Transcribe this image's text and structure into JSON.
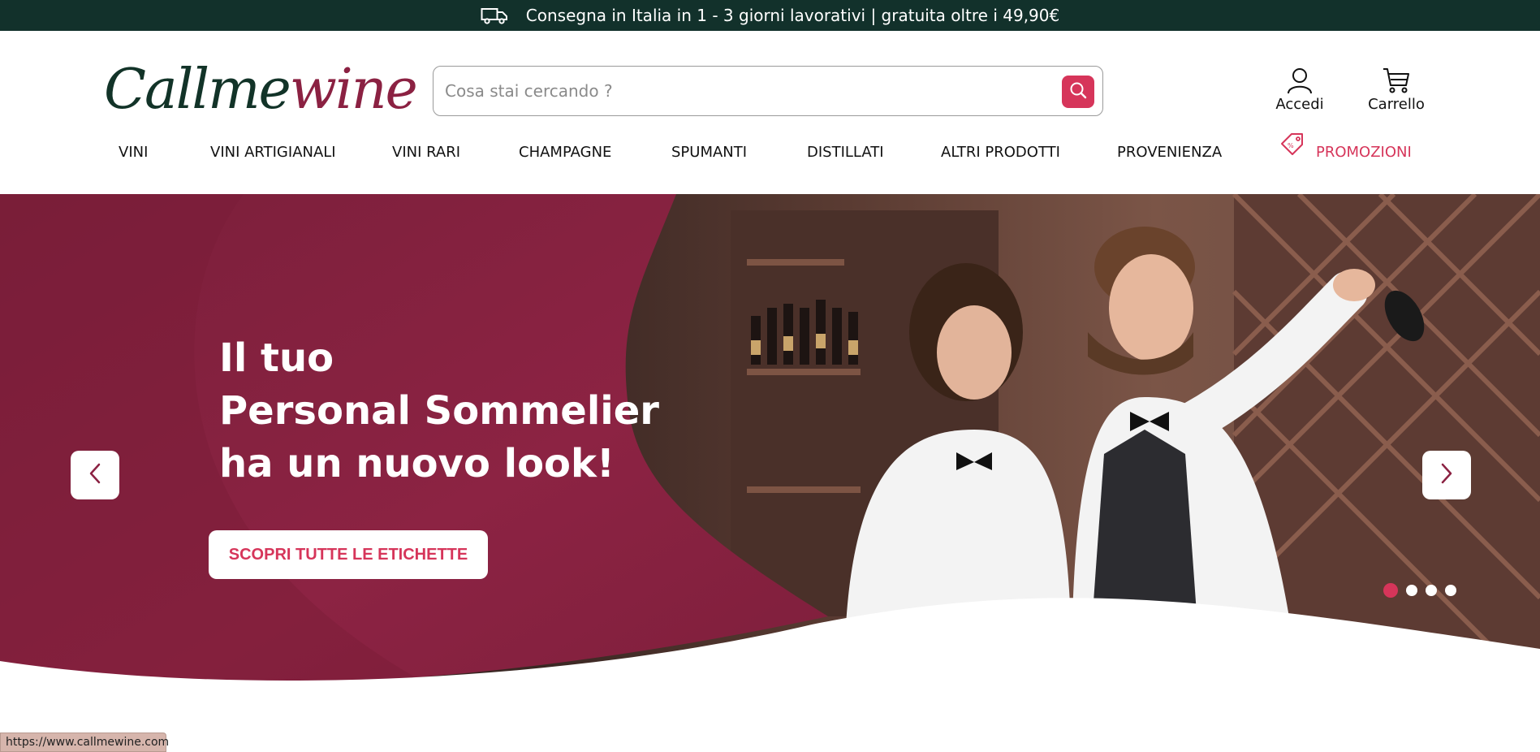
{
  "top_banner": {
    "icon": "truck-icon",
    "text": "Consegna in Italia in 1 - 3 giorni lavorativi | gratuita oltre i 49,90€"
  },
  "header": {
    "logo": {
      "part1": "Callme",
      "part2": "wine"
    },
    "search": {
      "placeholder": "Cosa stai cercando ?",
      "value": "",
      "icon": "search-icon"
    },
    "account": {
      "label": "Accedi",
      "icon": "user-icon"
    },
    "cart": {
      "label": "Carrello",
      "icon": "cart-icon"
    }
  },
  "nav": {
    "items": [
      {
        "label": "VINI"
      },
      {
        "label": "VINI ARTIGIANALI"
      },
      {
        "label": "VINI RARI"
      },
      {
        "label": "CHAMPAGNE"
      },
      {
        "label": "SPUMANTI"
      },
      {
        "label": "DISTILLATI"
      },
      {
        "label": "ALTRI PRODOTTI"
      },
      {
        "label": "PROVENIENZA"
      },
      {
        "label": "PROMOZIONI",
        "icon": "tag-icon"
      }
    ]
  },
  "hero": {
    "title_lines": [
      "Il tuo",
      "Personal Sommelier",
      "ha un nuovo look!"
    ],
    "cta_label": "SCOPRI TUTTE LE ETICHETTE",
    "slides_total": 4,
    "active_slide": 1
  },
  "status_bar": {
    "url": "https://www.callmewine.com"
  },
  "colors": {
    "banner_bg": "#12312b",
    "brand_green": "#123328",
    "brand_wine": "#8b2142",
    "accent": "#d6355a",
    "hero_wine": "#8a2240"
  }
}
